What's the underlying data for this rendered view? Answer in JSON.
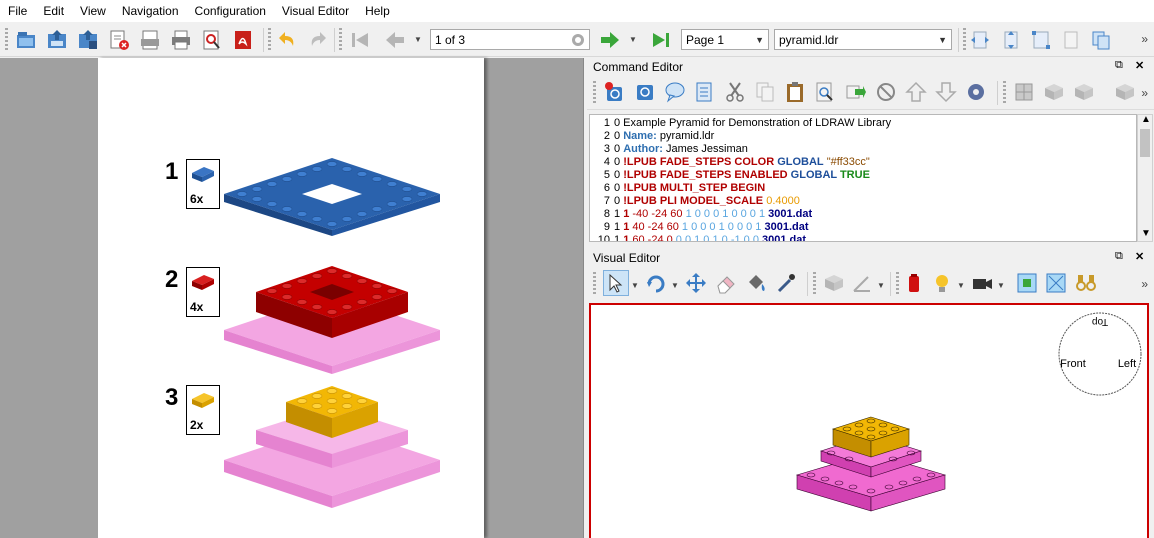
{
  "menu": [
    "File",
    "Edit",
    "View",
    "Navigation",
    "Configuration",
    "Visual Editor",
    "Help"
  ],
  "toolbar": {
    "page_input": "1 of 3",
    "page_select": "Page 1",
    "file_select": "pyramid.ldr",
    "more": "»"
  },
  "instructions": {
    "steps": [
      {
        "number": "1",
        "qty": "6x",
        "color": "#1e5aa8"
      },
      {
        "number": "2",
        "qty": "4x",
        "color": "#c40000"
      },
      {
        "number": "3",
        "qty": "2x",
        "color": "#f2b705"
      }
    ],
    "base_color": "#f090d8"
  },
  "command_editor": {
    "title": "Command Editor",
    "float_btn": "⧉",
    "close_btn": "✕",
    "more": "»",
    "lines": [
      {
        "n": "1",
        "parts": [
          {
            "t": "0 Example Pyramid for Demonstration of LDRAW Library",
            "c": "#000"
          }
        ]
      },
      {
        "n": "2",
        "parts": [
          {
            "t": "0 ",
            "c": "#000"
          },
          {
            "t": "Name:",
            "c": "#2f6fb0",
            "b": true
          },
          {
            "t": " pyramid.ldr",
            "c": "#000"
          }
        ]
      },
      {
        "n": "3",
        "parts": [
          {
            "t": "0 ",
            "c": "#000"
          },
          {
            "t": "Author:",
            "c": "#2f6fb0",
            "b": true
          },
          {
            "t": " James Jessiman",
            "c": "#000"
          }
        ]
      },
      {
        "n": "4",
        "parts": [
          {
            "t": "0 ",
            "c": "#000"
          },
          {
            "t": "!LPUB FADE_STEPS COLOR",
            "c": "#b00000",
            "b": true
          },
          {
            "t": " GLOBAL",
            "c": "#1d4e9a",
            "b": true
          },
          {
            "t": " \"#ff33cc\"",
            "c": "#8a4a00"
          }
        ]
      },
      {
        "n": "5",
        "parts": [
          {
            "t": "0 ",
            "c": "#000"
          },
          {
            "t": "!LPUB FADE_STEPS ENABLED",
            "c": "#b00000",
            "b": true
          },
          {
            "t": " GLOBAL",
            "c": "#1d4e9a",
            "b": true
          },
          {
            "t": " TRUE",
            "c": "#1a8a1a",
            "b": true
          }
        ]
      },
      {
        "n": "6",
        "parts": [
          {
            "t": "0 ",
            "c": "#000"
          },
          {
            "t": "!LPUB MULTI_STEP BEGIN",
            "c": "#b00000",
            "b": true
          }
        ]
      },
      {
        "n": "7",
        "parts": [
          {
            "t": "0 ",
            "c": "#000"
          },
          {
            "t": "!LPUB PLI MODEL_SCALE",
            "c": "#b00000",
            "b": true
          },
          {
            "t": " 0.4000",
            "c": "#e89a00"
          }
        ]
      },
      {
        "n": "8",
        "parts": [
          {
            "t": "1 ",
            "c": "#000"
          },
          {
            "t": "1",
            "c": "#b00000",
            "b": true
          },
          {
            "t": " -40 -24 60",
            "c": "#b00000"
          },
          {
            "t": " 1 0 0 0 1 0 0 0 1",
            "c": "#5aa6e0"
          },
          {
            "t": " 3001.dat",
            "c": "#000080",
            "b": true
          }
        ]
      },
      {
        "n": "9",
        "parts": [
          {
            "t": "1 ",
            "c": "#000"
          },
          {
            "t": "1",
            "c": "#b00000",
            "b": true
          },
          {
            "t": " 40 -24 60",
            "c": "#b00000"
          },
          {
            "t": " 1 0 0 0 1 0 0 0 1",
            "c": "#5aa6e0"
          },
          {
            "t": " 3001.dat",
            "c": "#000080",
            "b": true
          }
        ]
      },
      {
        "n": "10",
        "parts": [
          {
            "t": "1 ",
            "c": "#000"
          },
          {
            "t": "1",
            "c": "#b00000",
            "b": true
          },
          {
            "t": " 60 -24 0",
            "c": "#b00000"
          },
          {
            "t": " 0 0 1 0 1 0 -1 0 0",
            "c": "#5aa6e0"
          },
          {
            "t": " 3001.dat",
            "c": "#000080",
            "b": true
          }
        ]
      }
    ]
  },
  "visual_editor": {
    "title": "Visual Editor",
    "float_btn": "⧉",
    "close_btn": "✕",
    "more": "»",
    "viewcube": {
      "top": "Top",
      "front": "Front",
      "left": "Left"
    }
  },
  "colors": {
    "accent_red": "#c00000",
    "lego_blue": "#1e5aa8",
    "lego_red": "#c40000",
    "lego_yellow": "#f2b705",
    "lego_pink": "#f090d8"
  }
}
